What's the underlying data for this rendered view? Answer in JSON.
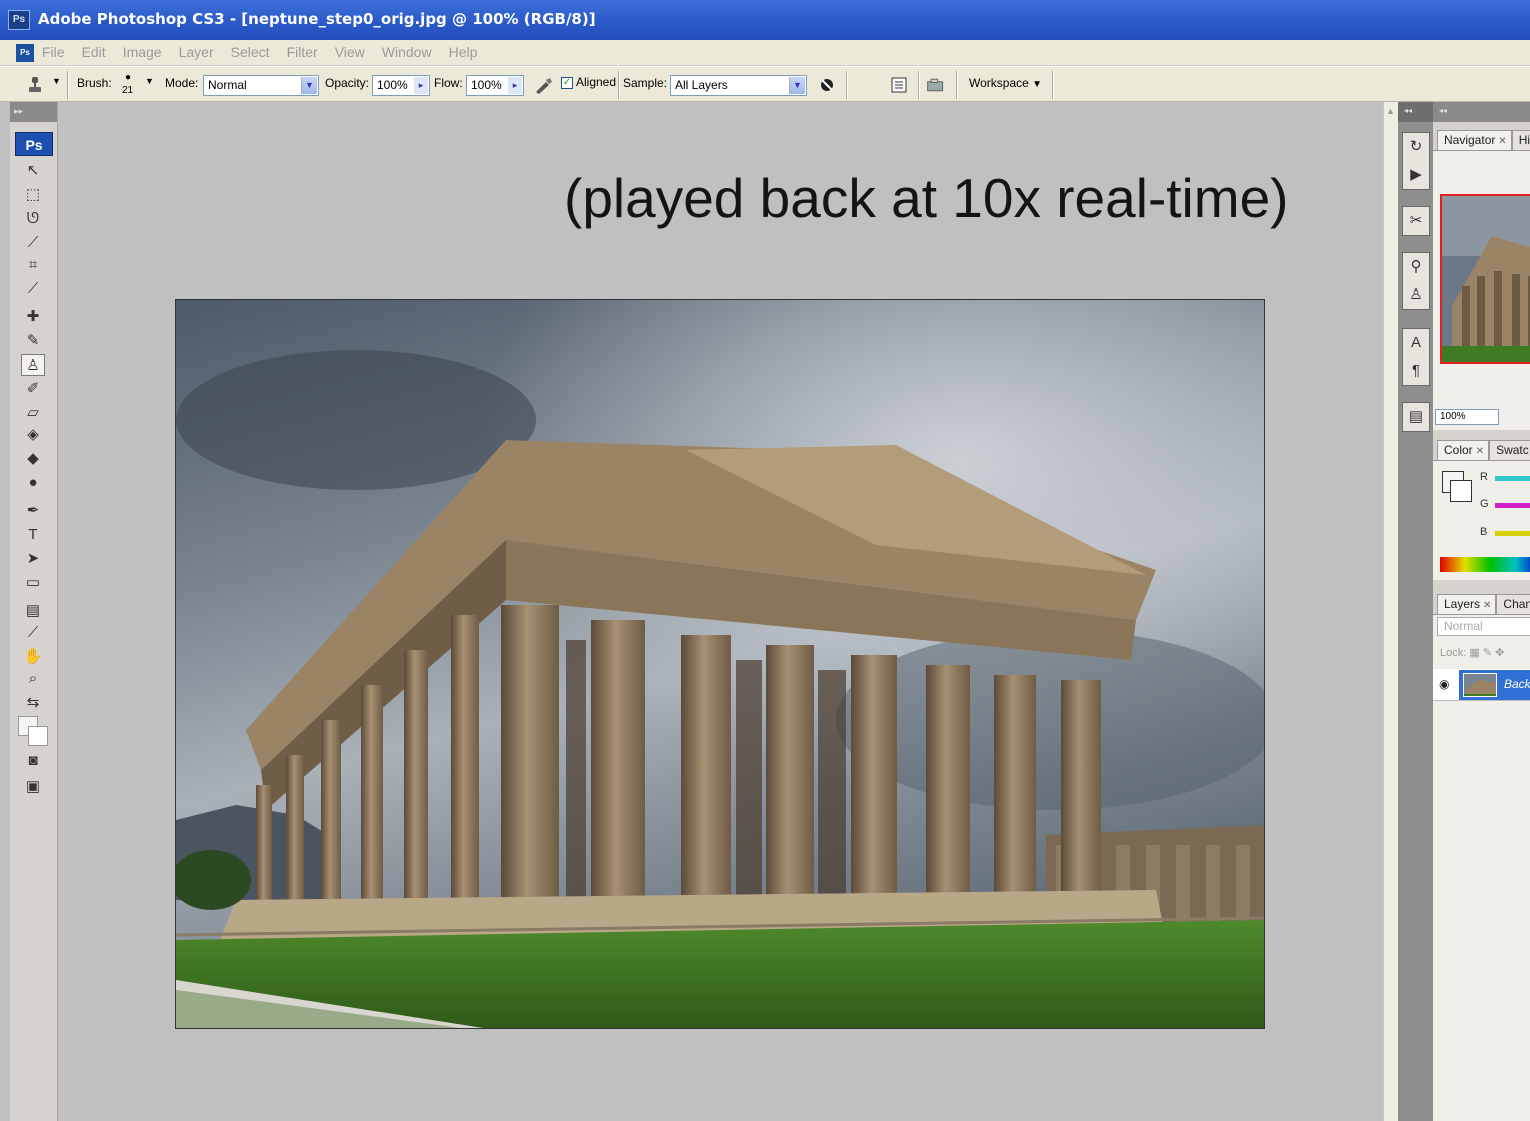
{
  "window": {
    "app_icon_label": "Ps",
    "title": "Adobe Photoshop CS3 - [neptune_step0_orig.jpg @ 100% (RGB/8)]"
  },
  "menu": {
    "doc_icon_label": "Ps",
    "items": [
      "File",
      "Edit",
      "Image",
      "Layer",
      "Select",
      "Filter",
      "View",
      "Window",
      "Help"
    ]
  },
  "options_bar": {
    "brush_label": "Brush:",
    "brush_size": "21",
    "mode_label": "Mode:",
    "mode_value": "Normal",
    "opacity_label": "Opacity:",
    "opacity_value": "100%",
    "flow_label": "Flow:",
    "flow_value": "100%",
    "aligned_label": "Aligned",
    "aligned_checked": true,
    "sample_label": "Sample:",
    "sample_value": "All Layers",
    "workspace_label": "Workspace"
  },
  "toolbox": {
    "badge": "Ps",
    "tools": [
      {
        "name": "move-tool-icon",
        "glyph": "↖"
      },
      {
        "name": "marquee-tool-icon",
        "glyph": "⬚"
      },
      {
        "name": "lasso-tool-icon",
        "glyph": "ᘎ"
      },
      {
        "name": "magic-wand-tool-icon",
        "glyph": "⟋"
      },
      {
        "name": "crop-tool-icon",
        "glyph": "⌗"
      },
      {
        "name": "slice-tool-icon",
        "glyph": "⟋"
      },
      {
        "name": "healing-brush-tool-icon",
        "glyph": "✚"
      },
      {
        "name": "brush-tool-icon",
        "glyph": "✎"
      },
      {
        "name": "clone-stamp-tool-icon",
        "glyph": "♙"
      },
      {
        "name": "history-brush-tool-icon",
        "glyph": "✐"
      },
      {
        "name": "eraser-tool-icon",
        "glyph": "▱"
      },
      {
        "name": "paint-bucket-tool-icon",
        "glyph": "◈"
      },
      {
        "name": "blur-tool-icon",
        "glyph": "◆"
      },
      {
        "name": "dodge-tool-icon",
        "glyph": "●"
      },
      {
        "name": "pen-tool-icon",
        "glyph": "✒"
      },
      {
        "name": "type-tool-icon",
        "glyph": "T"
      },
      {
        "name": "path-selection-tool-icon",
        "glyph": "➤"
      },
      {
        "name": "rectangle-tool-icon",
        "glyph": "▭"
      },
      {
        "name": "notes-tool-icon",
        "glyph": "▤"
      },
      {
        "name": "eyedropper-tool-icon",
        "glyph": "⟋"
      },
      {
        "name": "hand-tool-icon",
        "glyph": "✋"
      },
      {
        "name": "zoom-tool-icon",
        "glyph": "⌕"
      },
      {
        "name": "swap-colors-icon",
        "glyph": "⇆"
      },
      {
        "name": "quick-mask-icon",
        "glyph": "◙"
      },
      {
        "name": "screen-mode-icon",
        "glyph": "▣"
      }
    ]
  },
  "canvas": {
    "overlay_text": "(played back at 10x real-time)"
  },
  "panels": {
    "navigator_tab": "Navigator",
    "histogram_tab": "Hi",
    "zoom_value": "100%",
    "color_tab": "Color",
    "swatches_tab": "Swatc",
    "color_channels": [
      "R",
      "G",
      "B"
    ],
    "channel_colors": [
      "#30c8c8",
      "#d020c8",
      "#d8d000"
    ],
    "layers_tab": "Layers",
    "channels_tab": "Chan",
    "blend_mode": "Normal",
    "lock_label": "Lock:",
    "layer_name": "Back"
  },
  "colors": {
    "titlebar": "#2a58c8",
    "menu_bg": "#ece9d8",
    "workspace_bg": "#c0c0c0",
    "selected_layer": "#2f6fd6"
  }
}
